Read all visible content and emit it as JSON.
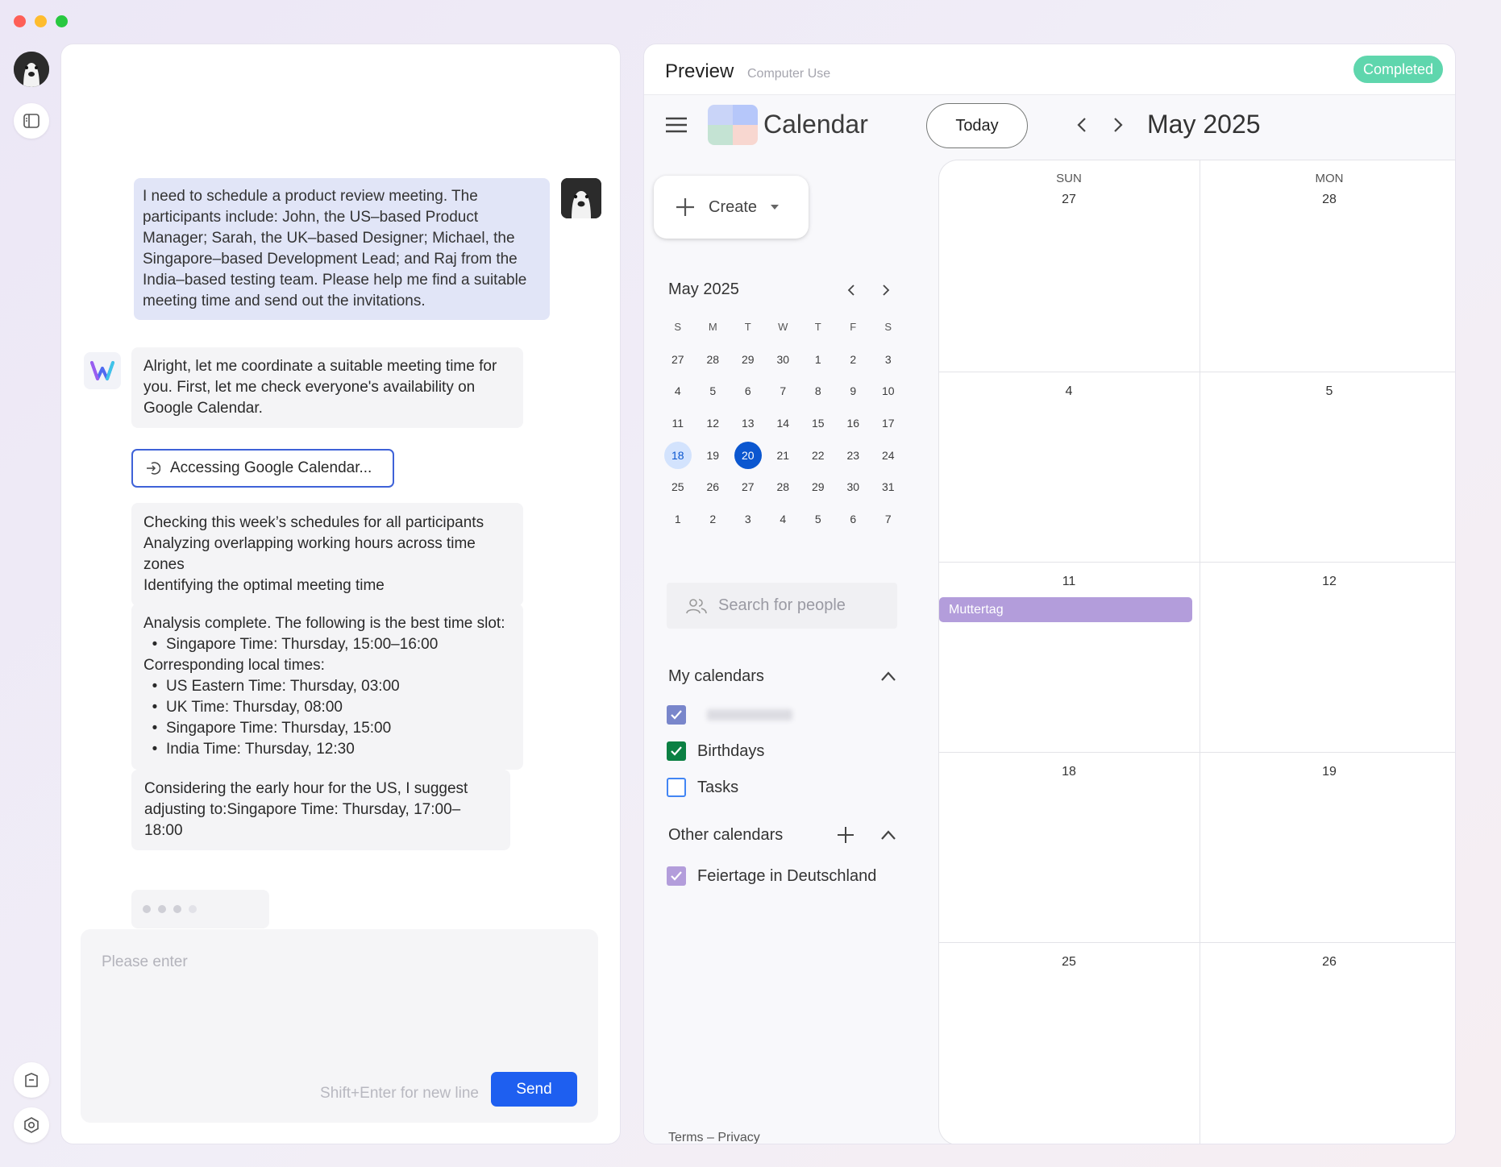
{
  "chat": {
    "user_message": "I need to schedule a product review meeting. The participants include: John, the US–based Product Manager; Sarah, the UK–based Designer; Michael, the Singapore–based Development Lead; and Raj from the India–based testing team. Please help me find a suitable meeting time and send out the invitations.",
    "bot_intro": "Alright, let me coordinate a suitable meeting time for you. First, let me check everyone's availability on Google Calendar.",
    "tool_status": "Accessing Google Calendar...",
    "steps": [
      "Checking this week’s schedules for all participants",
      "Analyzing overlapping working hours across time zones",
      "Identifying the optimal meeting time"
    ],
    "analysis": {
      "heading": "Analysis complete. The following is the best time slot:",
      "best_slot": "Singapore Time: Thursday, 15:00–16:00",
      "local_heading": "Corresponding local times:",
      "local_times": [
        "US Eastern Time: Thursday, 03:00",
        "UK Time: Thursday, 08:00",
        "Singapore Time: Thursday, 15:00",
        "India Time: Thursday, 12:30"
      ]
    },
    "suggestion": "Considering the early hour for the US, I suggest adjusting to:Singapore Time: Thursday, 17:00–18:00",
    "input_placeholder": "Please enter",
    "input_hint": "Shift+Enter for new line",
    "send_label": "Send"
  },
  "preview": {
    "title": "Preview",
    "subtitle": "Computer Use",
    "status": "Completed"
  },
  "calendar": {
    "app_name": "Calendar",
    "today_label": "Today",
    "month_label": "May 2025",
    "create_label": "Create",
    "mini": {
      "month": "May 2025",
      "weekday_headers": [
        "S",
        "M",
        "T",
        "W",
        "T",
        "F",
        "S"
      ],
      "weeks": [
        [
          "27",
          "28",
          "29",
          "30",
          "1",
          "2",
          "3"
        ],
        [
          "4",
          "5",
          "6",
          "7",
          "8",
          "9",
          "10"
        ],
        [
          "11",
          "12",
          "13",
          "14",
          "15",
          "16",
          "17"
        ],
        [
          "18",
          "19",
          "20",
          "21",
          "22",
          "23",
          "24"
        ],
        [
          "25",
          "26",
          "27",
          "28",
          "29",
          "30",
          "31"
        ],
        [
          "1",
          "2",
          "3",
          "4",
          "5",
          "6",
          "7"
        ]
      ],
      "selected_day": "18",
      "current_day": "20"
    },
    "search_placeholder": "Search for people",
    "my_calendars_title": "My calendars",
    "my_calendars": [
      {
        "name": "",
        "checked": true,
        "color": "#7986cb"
      },
      {
        "name": "Birthdays",
        "checked": true,
        "color": "#0b8043"
      },
      {
        "name": "Tasks",
        "checked": false,
        "color": "#4285f4"
      }
    ],
    "other_calendars_title": "Other calendars",
    "other_calendars": [
      {
        "name": "Feiertage in Deutschland",
        "checked": true,
        "color": "#b39ddb"
      }
    ],
    "footer": "Terms – Privacy",
    "columns": [
      {
        "dow": "SUN",
        "days": [
          "27",
          "4",
          "11",
          "18",
          "25"
        ]
      },
      {
        "dow": "MON",
        "days": [
          "28",
          "5",
          "12",
          "19",
          "26"
        ]
      }
    ],
    "event": {
      "title": "Muttertag",
      "color": "#b39ddb"
    }
  }
}
